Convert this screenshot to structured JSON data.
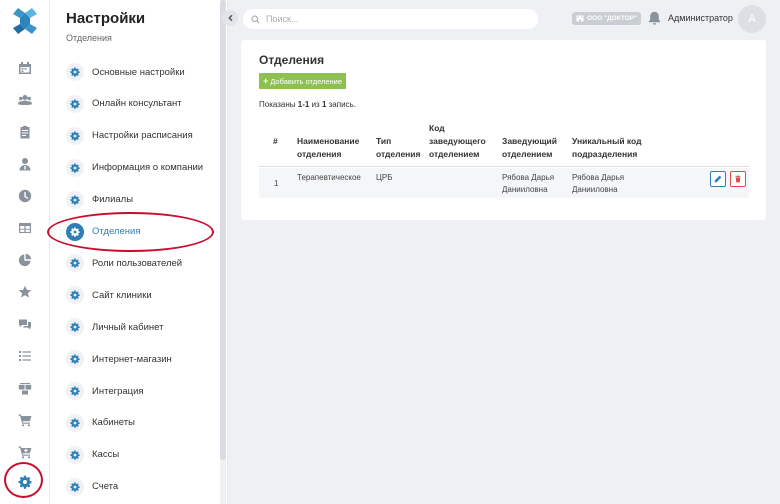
{
  "sidebar": {
    "title": "Настройки",
    "subtitle": "Отделения",
    "items": [
      {
        "label": "Основные настройки"
      },
      {
        "label": "Онлайн консультант"
      },
      {
        "label": "Настройки расписания"
      },
      {
        "label": "Информация о компании"
      },
      {
        "label": "Филиалы"
      },
      {
        "label": "Отделения",
        "active": true
      },
      {
        "label": "Роли пользователей"
      },
      {
        "label": "Сайт клиники"
      },
      {
        "label": "Личный кабинет"
      },
      {
        "label": "Интернет-магазин"
      },
      {
        "label": "Интеграция"
      },
      {
        "label": "Кабинеты"
      },
      {
        "label": "Кассы"
      },
      {
        "label": "Счета"
      }
    ]
  },
  "rail": {
    "icons": [
      "calendar-icon",
      "users-icon",
      "clipboard-icon",
      "doctor-icon",
      "clock-icon",
      "table-icon",
      "pie-chart-icon",
      "star-icon",
      "chat-icon",
      "list-icon",
      "boxes-icon",
      "cart-icon",
      "cart-plus-icon",
      "settings-gear-icon"
    ],
    "active": "settings-gear-icon"
  },
  "topbar": {
    "search_placeholder": "Поиск...",
    "org_badge": "ООО \"ДОКТОР\"",
    "user_name": "Администратор",
    "avatar_letter": "А"
  },
  "main": {
    "title": "Отделения",
    "add_button": "Добавить отделение",
    "summary": {
      "prefix": "Показаны",
      "range": "1-1",
      "mid": "из",
      "total": "1",
      "suffix": "запись."
    },
    "table": {
      "headers": [
        "#",
        "Наименование отделения",
        "Тип отделения",
        "Код заведующего отделением",
        "Заведующий отделением",
        "Уникальный код подразделения"
      ],
      "rows": [
        [
          "1",
          "Терапевтическое",
          "ЦРБ",
          "",
          "Рябова Дарья Данииловна",
          "Рябова Дарья Данииловна"
        ]
      ]
    }
  },
  "colors": {
    "accent": "#2f7fb6",
    "add_button": "#8cc152",
    "delete": "#e04b4a",
    "annotation": "#c8102e"
  }
}
